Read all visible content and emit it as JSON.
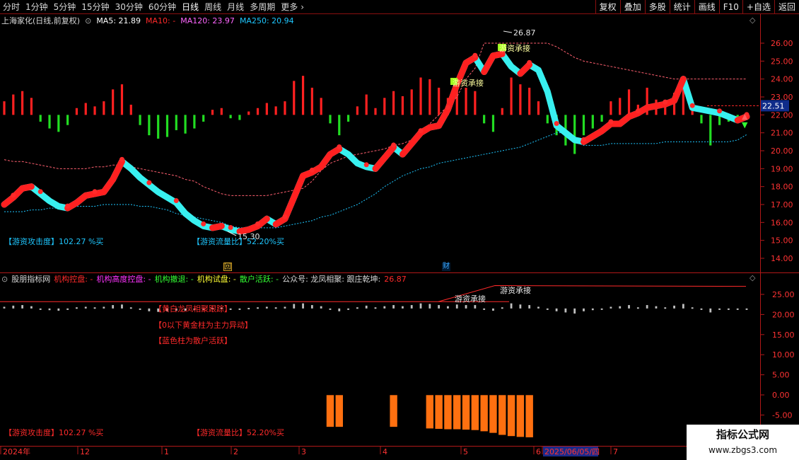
{
  "toolbar": {
    "periods": [
      "分时",
      "1分钟",
      "5分钟",
      "15分钟",
      "30分钟",
      "60分钟",
      "日线",
      "周线",
      "月线",
      "多周期",
      "更多"
    ],
    "active_period": "日线",
    "more_icon": "chevron-right-icon",
    "right_buttons": [
      "复权",
      "叠加",
      "多股",
      "统计",
      "画线",
      "F10",
      "+自选",
      "返回"
    ]
  },
  "main_panel": {
    "title": "上海家化(日线,前复权)",
    "ma": [
      {
        "label": "MA5: 21.89",
        "color": "#ffffff"
      },
      {
        "label": "MA10: -",
        "color": "#ff2a2a"
      },
      {
        "label": "MA120: 23.97",
        "color": "#ff66ff"
      },
      {
        "label": "MA250: 20.94",
        "color": "#1ec7ff"
      }
    ],
    "left_label": "【游资攻击度】102.27 %买",
    "mid_label": "【游资流量比】52.20%买",
    "marker_hui": "回",
    "marker_cai": "财"
  },
  "sub_panel": {
    "title": "股朋指标网",
    "items": [
      {
        "label": "机构控盘: -",
        "color": "#ff2a2a"
      },
      {
        "label": "机构高度控盘: -",
        "color": "#ff33ff"
      },
      {
        "label": "机构撤退: -",
        "color": "#33ff33"
      },
      {
        "label": "机构试盘: -",
        "color": "#ffff33"
      },
      {
        "label": "散户活跃: -",
        "color": "#33ff33"
      },
      {
        "label": "公众号: 龙凤相聚: 跟庄乾坤:",
        "color": "#d8d8d8"
      },
      {
        "label": "26.87",
        "color": "#ff2a2a"
      }
    ],
    "notes": [
      "【黄白龙凤相聚跟踪】",
      "【0以下黄金柱为主力异动】",
      "【蓝色柱为散户活跃】"
    ],
    "left_label": "【游资攻击度】102.27 %买",
    "mid_label": "【游资流量比】52.20%买"
  },
  "time_axis": {
    "labels": [
      "2024年",
      "12",
      "1",
      "2",
      "3",
      "4",
      "5",
      "6",
      "2025/06/05/四",
      "7"
    ]
  },
  "watermark": {
    "line1": "指标公式网",
    "line2": "www.zbgs3.com"
  },
  "chart_data": [
    {
      "type": "line",
      "name": "main-price",
      "y_ticks": [
        14.0,
        15.0,
        16.0,
        17.0,
        18.0,
        19.0,
        20.0,
        21.0,
        22.0,
        23.0,
        24.0,
        25.0,
        26.0
      ],
      "y_tick_labels": [
        "14.00",
        "15.00",
        "16.00",
        "17.00",
        "18.00",
        "19.00",
        "20.00",
        "21.00",
        "22.00",
        "23.00",
        "24.00",
        "25.00",
        "26.00"
      ],
      "ylim": [
        13.4,
        26.9
      ],
      "current_price": 22.51,
      "current_price_label": "22.51",
      "high_label": "26.87",
      "low_label": "15.30",
      "annotations": [
        "游资承接",
        "游资承接"
      ],
      "price": [
        17.0,
        17.4,
        17.9,
        18.0,
        17.6,
        17.2,
        16.9,
        16.8,
        17.1,
        17.5,
        17.6,
        17.7,
        18.4,
        19.4,
        19.0,
        18.5,
        18.1,
        17.7,
        17.4,
        17.1,
        16.5,
        16.1,
        15.8,
        15.7,
        15.8,
        15.6,
        15.5,
        15.6,
        15.8,
        16.2,
        15.9,
        16.2,
        17.4,
        18.6,
        18.8,
        19.1,
        19.8,
        20.1,
        19.8,
        19.3,
        19.1,
        19.0,
        19.6,
        20.2,
        19.8,
        20.4,
        21.0,
        21.3,
        21.4,
        22.3,
        23.7,
        24.9,
        25.2,
        24.4,
        25.3,
        25.4,
        24.7,
        24.3,
        24.8,
        24.5,
        23.3,
        21.4,
        21.0,
        20.6,
        20.5,
        20.8,
        21.1,
        21.5,
        21.5,
        21.9,
        22.1,
        22.4,
        22.5,
        22.6,
        22.8,
        24.0,
        22.4,
        22.3,
        22.2,
        22.1,
        21.9,
        21.7,
        21.9
      ],
      "ma120": [
        19.5,
        19.4,
        19.4,
        19.3,
        19.2,
        19.1,
        19.0,
        19.0,
        19.0,
        19.0,
        19.1,
        19.1,
        19.2,
        19.2,
        19.1,
        19.0,
        18.9,
        18.8,
        18.7,
        18.6,
        18.4,
        18.3,
        18.0,
        17.8,
        17.6,
        17.5,
        17.5,
        17.5,
        17.5,
        17.5,
        17.6,
        17.7,
        17.8,
        17.9,
        18.3,
        18.9,
        19.3,
        19.5,
        19.7,
        19.8,
        19.9,
        20.0,
        20.1,
        20.3,
        20.4,
        20.6,
        21.0,
        21.5,
        22.0,
        22.5,
        23.0,
        24.0,
        24.6,
        26.0,
        26.0,
        26.0,
        26.0,
        26.0,
        26.0,
        26.0,
        26.0,
        25.8,
        25.5,
        25.2,
        25.0,
        24.9,
        24.8,
        24.7,
        24.6,
        24.5,
        24.4,
        24.3,
        24.2,
        24.1,
        24.0,
        24.0,
        24.0,
        24.0,
        24.0,
        24.0,
        24.0,
        24.0,
        24.0
      ],
      "ma250": [
        16.6,
        16.6,
        16.6,
        16.7,
        16.7,
        16.8,
        16.8,
        16.8,
        16.9,
        16.9,
        16.9,
        17.0,
        17.0,
        17.0,
        17.0,
        16.9,
        16.9,
        16.8,
        16.7,
        16.5,
        16.4,
        16.3,
        16.2,
        16.1,
        16.0,
        15.8,
        15.7,
        15.7,
        15.7,
        15.7,
        15.7,
        15.8,
        15.9,
        16.0,
        16.1,
        16.3,
        16.4,
        16.6,
        16.8,
        17.0,
        17.3,
        17.6,
        18.0,
        18.3,
        18.6,
        18.8,
        19.0,
        19.1,
        19.3,
        19.4,
        19.5,
        19.6,
        19.7,
        19.8,
        19.9,
        20.0,
        20.1,
        20.2,
        20.4,
        20.6,
        20.8,
        21.0,
        21.0,
        20.5,
        20.3,
        20.3,
        20.3,
        20.4,
        20.4,
        20.4,
        20.4,
        20.4,
        20.4,
        20.5,
        20.5,
        20.5,
        20.5,
        20.5,
        20.5,
        20.5,
        20.5,
        20.6,
        20.9
      ],
      "indicator_hist": [
        0.8,
        1.2,
        1.4,
        1.0,
        -0.4,
        -0.8,
        -1.0,
        -0.6,
        0.4,
        0.7,
        0.5,
        0.8,
        1.5,
        1.8,
        0.6,
        -0.6,
        -1.2,
        -1.4,
        -1.3,
        -0.9,
        -1.1,
        -0.8,
        -0.4,
        0.3,
        0.4,
        -0.2,
        -0.3,
        0.2,
        0.4,
        0.7,
        0.5,
        0.8,
        2.0,
        2.3,
        1.6,
        1.0,
        -0.5,
        -1.2,
        -0.4,
        0.5,
        1.2,
        0.4,
        1.0,
        1.4,
        1.1,
        1.5,
        2.2,
        2.1,
        1.6,
        1.0,
        1.7,
        1.6,
        1.4,
        -0.5,
        -1.0,
        0.4,
        2.2,
        1.8,
        1.6,
        0.8,
        -0.5,
        -1.2,
        -1.8,
        -2.3,
        -1.2,
        -0.8,
        -0.4,
        0.8,
        1.0,
        1.5,
        0.6,
        1.6,
        0.9,
        0.6,
        1.3,
        2.0,
        0.5,
        -0.5,
        -1.8,
        -0.6,
        -0.4,
        -0.3,
        -0.3
      ]
    },
    {
      "type": "bar",
      "name": "sub-indicator",
      "y_ticks": [
        -5.0,
        0.0,
        5.0,
        10.0,
        15.0,
        20.0,
        25.0
      ],
      "y_tick_labels": [
        "-5.00",
        "0.00",
        "5.00",
        "10.00",
        "15.00",
        "20.00",
        "25.00"
      ],
      "ylim": [
        -8.0,
        28.0
      ],
      "baseline": 21.5,
      "threshold": 23.2,
      "upper": 27.0,
      "annotations": [
        "游资承接",
        "游资承接"
      ],
      "osc": [
        0.3,
        0.5,
        0.6,
        0.4,
        -0.2,
        -0.3,
        -0.4,
        -0.2,
        0.2,
        0.3,
        0.2,
        0.3,
        0.6,
        0.7,
        0.2,
        -0.2,
        -0.5,
        -0.6,
        -0.5,
        -0.4,
        -0.4,
        -0.3,
        -0.2,
        0.1,
        0.2,
        -0.1,
        -0.1,
        0.1,
        0.2,
        0.3,
        0.2,
        0.3,
        0.8,
        0.9,
        0.6,
        0.4,
        -0.2,
        -0.5,
        -0.2,
        0.2,
        0.5,
        0.2,
        0.4,
        0.6,
        0.4,
        0.6,
        0.9,
        0.8,
        0.6,
        0.4,
        0.7,
        0.6,
        0.6,
        -0.2,
        -0.4,
        0.2,
        0.9,
        0.7,
        0.6,
        0.3,
        -0.2,
        -0.5,
        -0.7,
        -0.9,
        -0.5,
        -0.3,
        -0.2,
        0.3,
        0.4,
        0.6,
        0.2,
        0.6,
        0.4,
        0.2,
        0.5,
        0.8,
        0.2,
        -0.2,
        -0.7,
        -0.2,
        -0.2,
        -0.1,
        -0.1
      ],
      "orange_bars": [
        {
          "i": 36,
          "low": -8.0
        },
        {
          "i": 37,
          "low": -8.0
        },
        {
          "i": 43,
          "low": -8.0
        },
        {
          "i": 47,
          "low": -8.4
        },
        {
          "i": 48,
          "low": -8.5
        },
        {
          "i": 49,
          "low": -8.6
        },
        {
          "i": 50,
          "low": -8.6
        },
        {
          "i": 51,
          "low": -8.7
        },
        {
          "i": 52,
          "low": -8.8
        },
        {
          "i": 53,
          "low": -9.1
        },
        {
          "i": 54,
          "low": -9.5
        },
        {
          "i": 55,
          "low": -10.0
        },
        {
          "i": 56,
          "low": -10.3
        },
        {
          "i": 57,
          "low": -10.5
        },
        {
          "i": 58,
          "low": -10.6
        }
      ]
    }
  ]
}
